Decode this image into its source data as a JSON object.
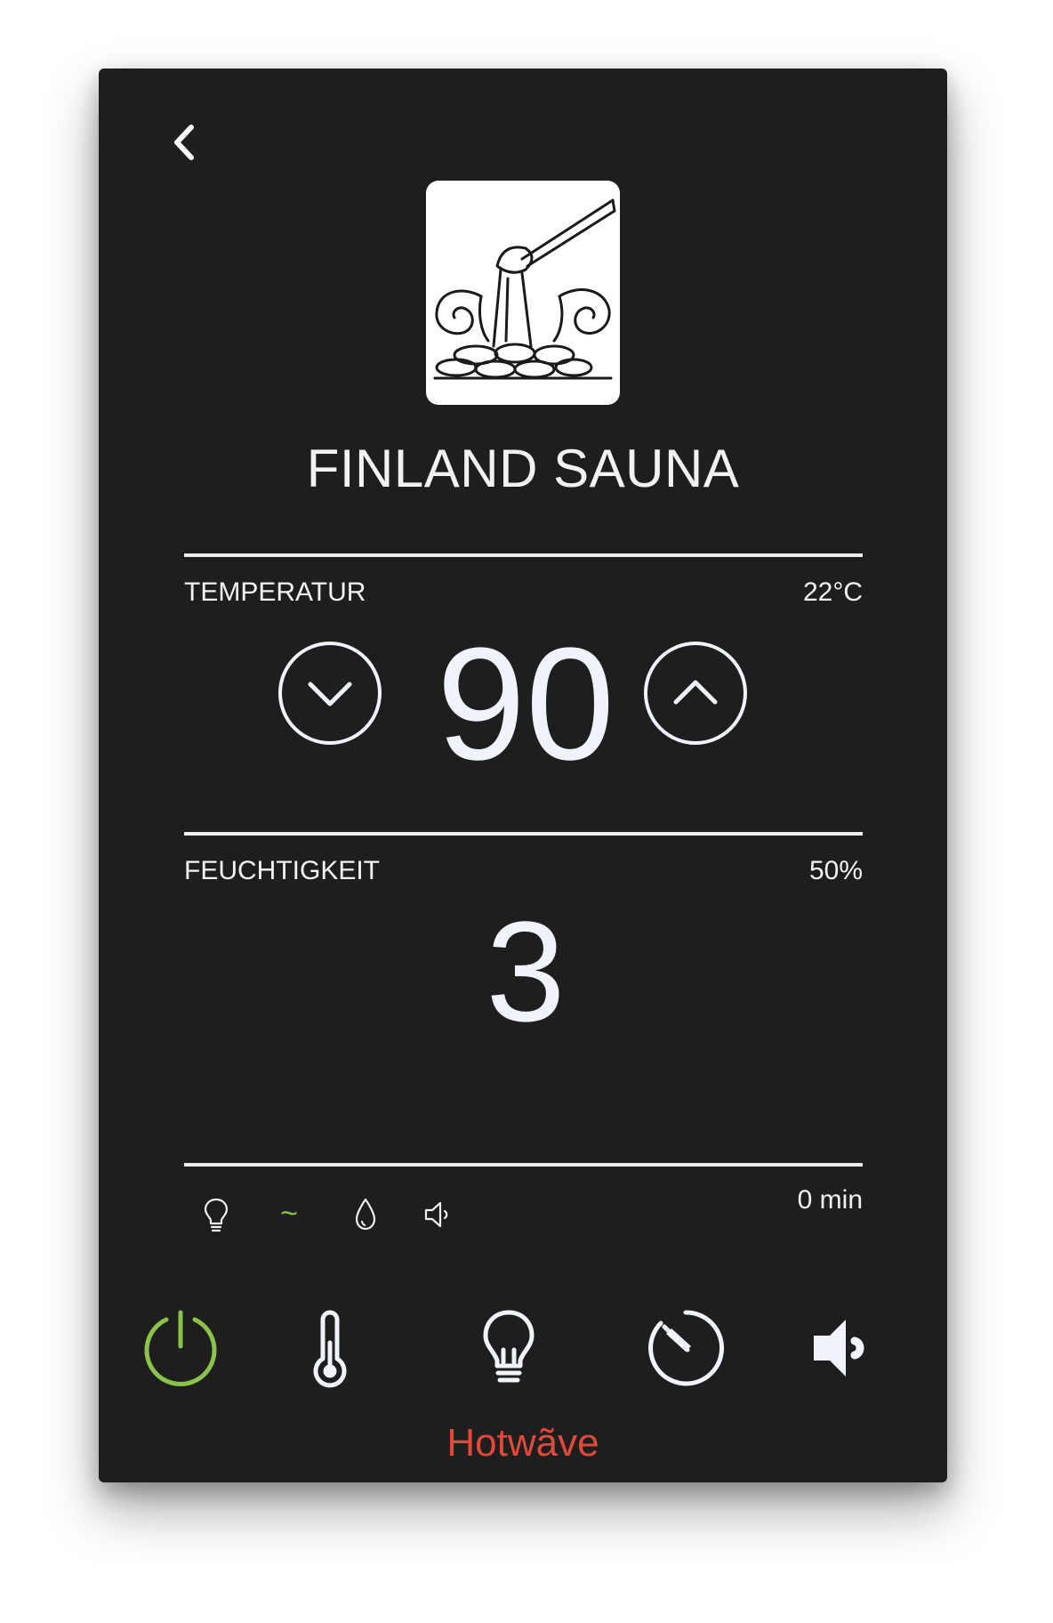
{
  "header": {
    "back_icon": "chevron-left-icon"
  },
  "program": {
    "image_icon": "sauna-ladle-stones-icon",
    "title": "FINLAND SAUNA"
  },
  "temperature": {
    "label": "TEMPERATUR",
    "current": "22°C",
    "setpoint": "90",
    "down_icon": "chevron-down-circle-icon",
    "up_icon": "chevron-up-circle-icon"
  },
  "humidity": {
    "label": "FEUCHTIGKEIT",
    "current": "50%",
    "level": "3"
  },
  "status": {
    "icons": [
      "lightbulb-icon",
      "tilde-icon",
      "drop-icon",
      "speaker-icon"
    ],
    "tilde": "~",
    "timer": "0 min",
    "active_color": "#8bc34a"
  },
  "toolbar": {
    "items": [
      "power-icon",
      "thermometer-icon",
      "lightbulb-icon",
      "timer-icon",
      "speaker-icon"
    ],
    "power_color": "#8bc34a"
  },
  "brand": {
    "name": "Hotwãve",
    "color": "#e0483a"
  }
}
